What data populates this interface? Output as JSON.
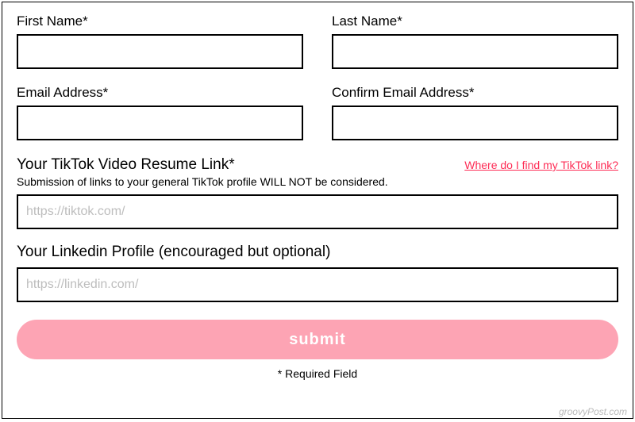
{
  "fields": {
    "firstName": {
      "label": "First Name*"
    },
    "lastName": {
      "label": "Last Name*"
    },
    "email": {
      "label": "Email Address*"
    },
    "confirmEmail": {
      "label": "Confirm Email Address*"
    },
    "tiktok": {
      "label": "Your TikTok Video Resume Link*",
      "helpLink": "Where do I find my TikTok link?",
      "subtext": "Submission of links to your general TikTok profile WILL NOT be considered.",
      "placeholder": "https://tiktok.com/"
    },
    "linkedin": {
      "label": "Your Linkedin Profile (encouraged but optional)",
      "placeholder": "https://linkedin.com/"
    }
  },
  "submit": {
    "label": "submit"
  },
  "requiredNote": "* Required Field",
  "watermark": "groovyPost.com"
}
